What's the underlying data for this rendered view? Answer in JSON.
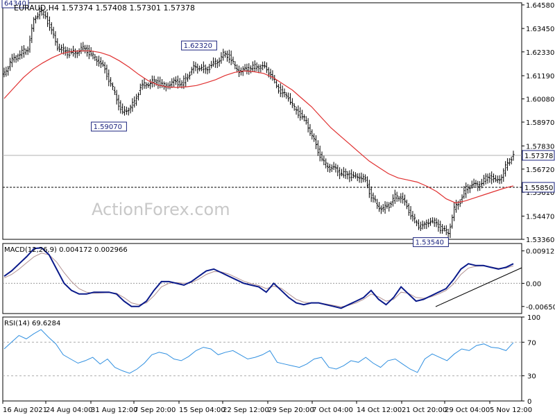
{
  "chart_data": [
    {
      "type": "candlestick",
      "header": "EURAUD,H4  1.57374 1.57408 1.57301 1.57378",
      "watermark": "ActionForex.com",
      "ylim": [
        1.5336,
        1.6468
      ],
      "y_ticks": [
        "1.64580",
        "1.63450",
        "1.62330",
        "1.61190",
        "1.60080",
        "1.58970",
        "1.57830",
        "1.56720",
        "1.55610",
        "1.54470",
        "1.53360"
      ],
      "current_price": 1.57378,
      "current_price_label": "1.57378",
      "horizontal_level": 1.5585,
      "horizontal_level_label": "1.55850",
      "annotations": [
        {
          "label": "64340",
          "value": 1.6434
        },
        {
          "label": "1.59070",
          "value": 1.5907
        },
        {
          "label": "1.62320",
          "value": 1.6232
        },
        {
          "label": "1.53540",
          "value": 1.5354
        }
      ],
      "series": [
        {
          "kind": "price",
          "color": "#000000",
          "values": [
            1.613,
            1.6185,
            1.6205,
            1.623,
            1.625,
            1.638,
            1.643,
            1.6405,
            1.633,
            1.626,
            1.624,
            1.6225,
            1.623,
            1.625,
            1.624,
            1.621,
            1.619,
            1.6145,
            1.608,
            1.601,
            1.5935,
            1.5965,
            1.599,
            1.6065,
            1.608,
            1.609,
            1.6085,
            1.607,
            1.608,
            1.609,
            1.608,
            1.612,
            1.6155,
            1.616,
            1.615,
            1.6165,
            1.619,
            1.622,
            1.621,
            1.616,
            1.614,
            1.615,
            1.616,
            1.6165,
            1.6155,
            1.613,
            1.607,
            1.603,
            1.602,
            1.596,
            1.593,
            1.59,
            1.583,
            1.576,
            1.57,
            1.568,
            1.567,
            1.565,
            1.565,
            1.563,
            1.564,
            1.562,
            1.554,
            1.55,
            1.548,
            1.55,
            1.554,
            1.554,
            1.549,
            1.544,
            1.54,
            1.54,
            1.543,
            1.541,
            1.538,
            1.537,
            1.548,
            1.552,
            1.558,
            1.56,
            1.559,
            1.562,
            1.564,
            1.561,
            1.564,
            1.57,
            1.5738
          ]
        },
        {
          "kind": "moving_average",
          "color": "#e03030",
          "values": [
            1.601,
            1.606,
            1.611,
            1.615,
            1.618,
            1.6205,
            1.6225,
            1.6235,
            1.6238,
            1.6238,
            1.623,
            1.6215,
            1.619,
            1.616,
            1.6125,
            1.6095,
            1.6075,
            1.6065,
            1.6063,
            1.6066,
            1.6072,
            1.6085,
            1.61,
            1.612,
            1.6135,
            1.6142,
            1.6138,
            1.613,
            1.611,
            1.608,
            1.605,
            1.601,
            1.597,
            1.592,
            1.587,
            1.583,
            1.579,
            1.575,
            1.571,
            1.568,
            1.565,
            1.563,
            1.562,
            1.561,
            1.559,
            1.5565,
            1.553,
            1.551,
            1.552,
            1.5535,
            1.555,
            1.5565,
            1.558,
            1.5592
          ]
        }
      ],
      "x_ticks": [
        "16 Aug 2021",
        "24 Aug 04:00",
        "31 Aug 12:00",
        "7 Sep 20:00",
        "15 Sep 04:00",
        "22 Sep 12:00",
        "29 Sep 20:00",
        "7 Oct 04:00",
        "14 Oct 12:00",
        "21 Oct 20:00",
        "29 Oct 04:00",
        "5 Nov 12:00"
      ]
    },
    {
      "type": "line",
      "header": "MACD(12,26,9) 0.004172 0.002966",
      "ylim": [
        -0.0085,
        0.0112
      ],
      "y_ticks": [
        "0.00912",
        "0.00",
        "-0.006506"
      ],
      "series": [
        {
          "name": "MACD",
          "color": "#0a1a8a",
          "values": [
            0.002,
            0.0035,
            0.0055,
            0.0075,
            0.0098,
            0.01,
            0.008,
            0.004,
            0.0,
            -0.002,
            -0.003,
            -0.003,
            -0.0025,
            -0.0025,
            -0.0025,
            -0.003,
            -0.005,
            -0.0065,
            -0.0065,
            -0.005,
            -0.002,
            0.0005,
            0.0005,
            0.0,
            -0.0005,
            0.0005,
            0.002,
            0.0035,
            0.004,
            0.003,
            0.002,
            0.001,
            0.0,
            -0.0005,
            -0.001,
            -0.0025,
            0.0,
            -0.002,
            -0.004,
            -0.0055,
            -0.006,
            -0.0055,
            -0.0055,
            -0.006,
            -0.0065,
            -0.007,
            -0.006,
            -0.005,
            -0.004,
            -0.002,
            -0.0045,
            -0.006,
            -0.004,
            -0.001,
            -0.003,
            -0.005,
            -0.0045,
            -0.0035,
            -0.0025,
            -0.0015,
            0.001,
            0.004,
            0.0055,
            0.005,
            0.005,
            0.0045,
            0.004,
            0.0045,
            0.0055
          ]
        },
        {
          "name": "Signal",
          "color": "#b09090",
          "values": [
            0.0015,
            0.0025,
            0.004,
            0.0058,
            0.0075,
            0.0085,
            0.008,
            0.006,
            0.003,
            0.0005,
            -0.0015,
            -0.0025,
            -0.0028,
            -0.0027,
            -0.0026,
            -0.0028,
            -0.004,
            -0.0055,
            -0.006,
            -0.0055,
            -0.0035,
            -0.001,
            0.0,
            0.0002,
            0.0,
            0.0002,
            0.0012,
            0.0025,
            0.0033,
            0.0032,
            0.0026,
            0.0016,
            0.0006,
            -0.0001,
            -0.0006,
            -0.0015,
            -0.0008,
            -0.0014,
            -0.003,
            -0.0045,
            -0.0053,
            -0.0055,
            -0.0055,
            -0.0058,
            -0.0062,
            -0.0066,
            -0.0062,
            -0.0055,
            -0.0045,
            -0.003,
            -0.0038,
            -0.005,
            -0.0045,
            -0.0025,
            -0.0028,
            -0.004,
            -0.0042,
            -0.0038,
            -0.003,
            -0.002,
            -0.0002,
            0.0025,
            0.0043,
            0.0048,
            0.0049,
            0.0046,
            0.0042,
            0.0043,
            0.0049
          ]
        }
      ]
    },
    {
      "type": "line",
      "header": "RSI(14) 69.6284",
      "ylim": [
        0,
        100
      ],
      "y_ticks": [
        "100",
        "70",
        "30",
        "0"
      ],
      "levels": [
        70,
        30
      ],
      "series": [
        {
          "name": "RSI",
          "color": "#2f8fe0",
          "values": [
            62,
            70,
            78,
            74,
            80,
            85,
            76,
            68,
            55,
            50,
            45,
            48,
            52,
            44,
            50,
            40,
            36,
            33,
            38,
            45,
            55,
            58,
            56,
            50,
            48,
            53,
            60,
            64,
            62,
            55,
            58,
            60,
            55,
            50,
            52,
            55,
            60,
            46,
            44,
            42,
            40,
            44,
            50,
            52,
            40,
            38,
            42,
            48,
            46,
            52,
            45,
            40,
            48,
            50,
            44,
            38,
            34,
            50,
            56,
            52,
            48,
            56,
            62,
            60,
            66,
            68,
            64,
            63,
            60,
            69.6
          ]
        }
      ]
    }
  ]
}
